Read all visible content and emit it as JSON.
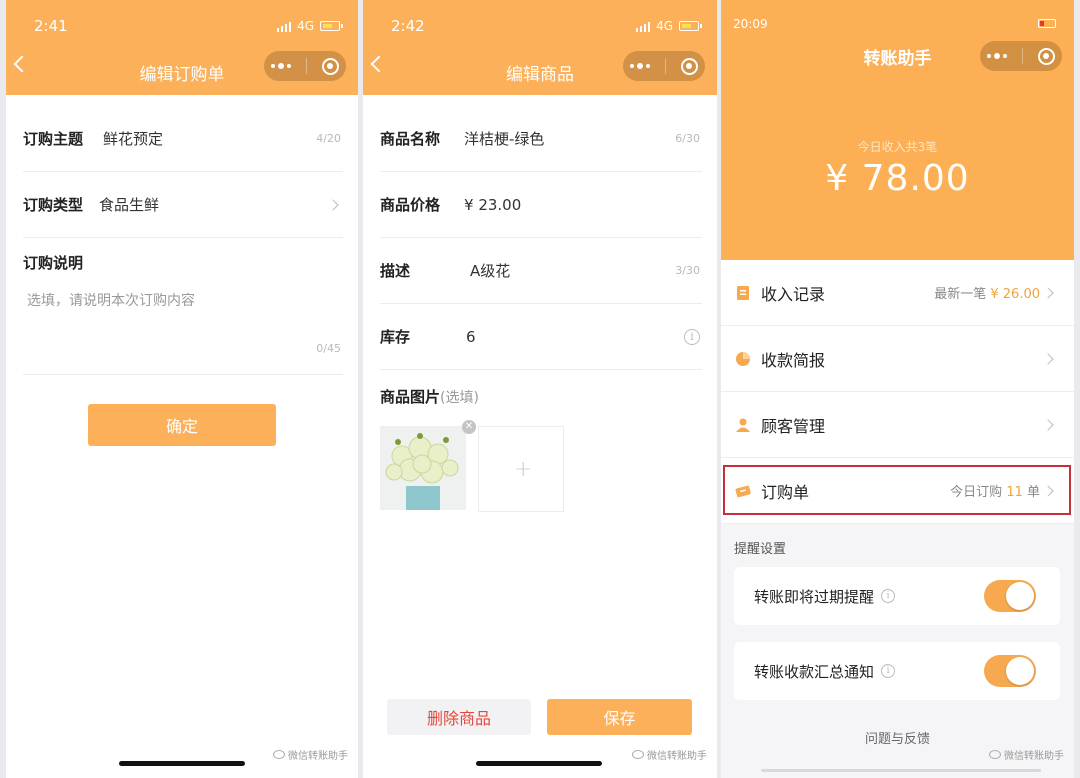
{
  "panel1": {
    "status": {
      "time": "2:41",
      "network": "4G"
    },
    "title": "编辑订购单",
    "fields": [
      {
        "label": "订购主题",
        "value": "鲜花预定",
        "counter": "4/20"
      },
      {
        "label": "订购类型",
        "value": "食品生鲜"
      }
    ],
    "description": {
      "label": "订购说明",
      "placeholder": "选填，请说明本次订购内容",
      "counter": "0/45"
    },
    "confirm_label": "确定",
    "watermark": "微信转账助手"
  },
  "panel2": {
    "status": {
      "time": "2:42",
      "network": "4G"
    },
    "title": "编辑商品",
    "fields": [
      {
        "label": "商品名称",
        "value": "洋桔梗-绿色",
        "counter": "6/30"
      },
      {
        "label": "商品价格",
        "value": "¥ 23.00"
      },
      {
        "label": "描述",
        "value": "A级花",
        "counter": "3/30"
      },
      {
        "label": "库存",
        "value": "6"
      }
    ],
    "image_label": "商品图片",
    "image_hint": "(选填)",
    "delete_label": "删除商品",
    "save_label": "保存",
    "watermark": "微信转账助手"
  },
  "panel3": {
    "status": {
      "time": "20:09"
    },
    "title": "转账助手",
    "income_subtitle": "今日收入共3笔",
    "income_amount": "¥ 78.00",
    "menu": [
      {
        "label": "收入记录",
        "extra_prefix": "最新一笔",
        "extra_value": "¥ 26.00",
        "extra_suffix": ""
      },
      {
        "label": "收款简报"
      },
      {
        "label": "顾客管理"
      },
      {
        "label": "订购单",
        "extra_prefix": "今日订购",
        "extra_value": "11",
        "extra_suffix": " 单"
      }
    ],
    "reminder_section": "提醒设置",
    "toggles": [
      {
        "label": "转账即将过期提醒",
        "on": true
      },
      {
        "label": "转账收款汇总通知",
        "on": true
      }
    ],
    "feedback_label": "问题与反馈",
    "watermark": "微信转账助手"
  },
  "colors": {
    "accent": "#fcb05a",
    "danger": "#e4473b",
    "highlight_box": "#c5303b"
  }
}
